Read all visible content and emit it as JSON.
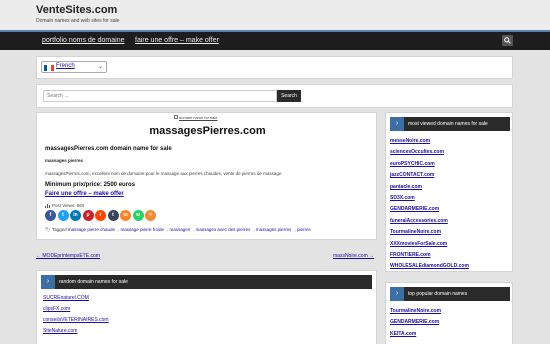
{
  "header": {
    "site_title": "VenteSites.com",
    "site_description": "Domain names and web sites for sale"
  },
  "nav": {
    "items": [
      {
        "label": "portfolio noms de domaine"
      },
      {
        "label": "faire une offre – make offer"
      }
    ],
    "search_icon": "search-icon"
  },
  "language": {
    "selected": "French",
    "flag_colors": [
      "#0055a4",
      "#ffffff",
      "#ef4135"
    ]
  },
  "search": {
    "placeholder": "Search ...",
    "button_label": "Search"
  },
  "post": {
    "breadcrumb": "domain name for sale",
    "title": "massagesPierres.com",
    "subtitle": "massagesPierres.com domain name for sale",
    "small_heading": "massages pierres",
    "description": "massagesPierres.com, excellent nom de domaine pour le massage aux pierres chaudes, vente de pierres de massage",
    "price": "Minimum prix/price: 2500 euros",
    "offer_link": "Faire une offre – make offer",
    "views": "Post Views: 660",
    "share_icons": [
      {
        "name": "facebook-icon",
        "glyph": "f",
        "color": "#3b5998"
      },
      {
        "name": "twitter-icon",
        "glyph": "t",
        "color": "#1da1f2"
      },
      {
        "name": "linkedin-icon",
        "glyph": "in",
        "color": "#0077b5"
      },
      {
        "name": "pinterest-icon",
        "glyph": "p",
        "color": "#cb2027"
      },
      {
        "name": "reddit-icon",
        "glyph": "r",
        "color": "#ff4500"
      },
      {
        "name": "tumblr-icon",
        "glyph": "t",
        "color": "#35465c"
      },
      {
        "name": "mix-icon",
        "glyph": "m",
        "color": "#ff8226"
      },
      {
        "name": "whatsapp-icon",
        "glyph": "w",
        "color": "#25d366"
      },
      {
        "name": "share-icon",
        "glyph": "<",
        "color": "#f28b35"
      }
    ],
    "tags_label": "Tagged",
    "tags": [
      "massage pierre chaude",
      "massage pierre froide",
      "massages",
      "massages avec des pierres",
      "massages pierres",
      "pierres"
    ]
  },
  "post_navigation": {
    "prev": "← MODEprintempsETE.com",
    "next": "massNoire.com →"
  },
  "random_widget": {
    "title": "random domain names for sale",
    "items": [
      "SUCREnaturel.COM",
      "clipsFX.com",
      "conseilsVETERINAIRES.com",
      "SiteNature.com"
    ]
  },
  "sidebar": {
    "most_viewed_title": "most viewed domain names for sale",
    "most_viewed": [
      "messeNoire.com",
      "sciencesOccultes.com",
      "euroPSYCHIC.com",
      "jazzCONTACT.com",
      "pantacle.com",
      "SD3X.com",
      "GENDARMERIE.com",
      "funeraiAccessories.com",
      "TourmalineNoire.com",
      "XXXmoviesForSale.com",
      "FRONTIERE.com",
      "WHOLESALEdiamondGOLD.com"
    ],
    "popular_title": "top popular domain names",
    "popular": [
      "TourmalineNoire.com",
      "GENDARMERIE.com",
      "KEITA.com"
    ]
  }
}
